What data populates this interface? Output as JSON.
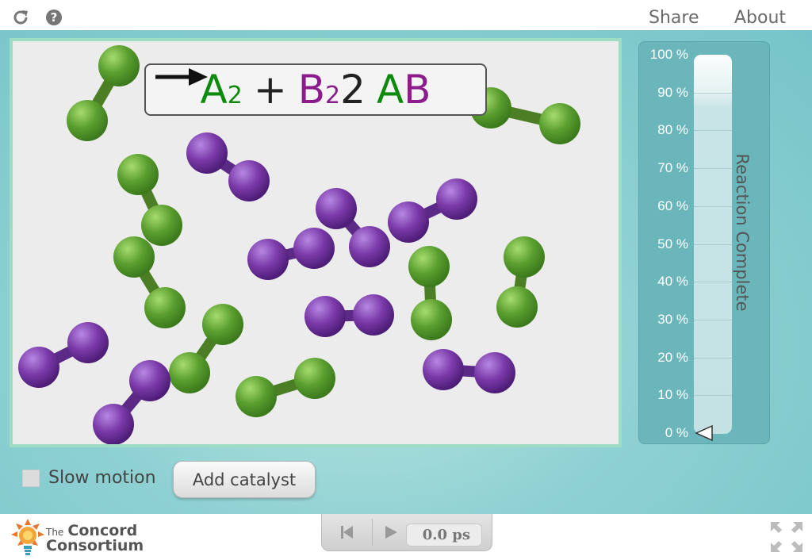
{
  "topbar": {
    "reload_icon": "reload-icon",
    "help_icon": "help-icon",
    "share_label": "Share",
    "about_label": "About"
  },
  "equation": {
    "a": "A",
    "a_sub": "2",
    "plus": "+",
    "b": "B",
    "b_sub": "2",
    "arrow_icon": "arrow-right-icon",
    "coef": "2",
    "ab_a": "A",
    "ab_b": "B"
  },
  "simulation": {
    "green_color": "#5a9e2f",
    "purple_color": "#7a3aa8"
  },
  "gauge": {
    "title": "Reaction Complete",
    "ticks": [
      "100 %",
      "90 %",
      "80 %",
      "70 %",
      "60 %",
      "50 %",
      "40 %",
      "30 %",
      "20 %",
      "10 %",
      "0 %"
    ],
    "value_percent": 0
  },
  "controls": {
    "slow_motion_label": "Slow motion",
    "slow_motion_checked": false,
    "add_catalyst_label": "Add catalyst"
  },
  "playback": {
    "rewind_icon": "rewind-icon",
    "play_icon": "play-icon",
    "time": "0.0 ps"
  },
  "footer": {
    "logo_line1": "The",
    "logo_line2": "Concord",
    "logo_line3": "Consortium",
    "fullscreen_icon": "fullscreen-icon"
  }
}
